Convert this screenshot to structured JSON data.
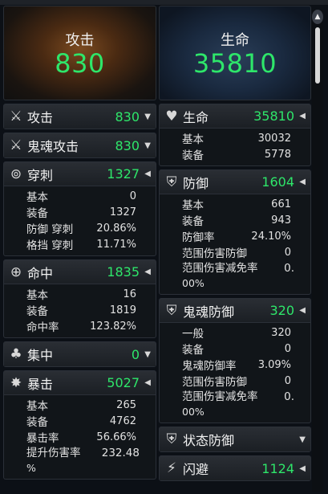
{
  "left": {
    "hero": {
      "label": "攻击",
      "value": "830"
    },
    "panels": [
      {
        "icon": "crossed-swords-icon",
        "glyph": "⚔",
        "title": "攻击",
        "value": "830",
        "arrow": "▼",
        "rows": []
      },
      {
        "icon": "crossed-swords-icon",
        "glyph": "⚔",
        "title": "鬼魂攻击",
        "value": "830",
        "arrow": "▼",
        "rows": []
      },
      {
        "icon": "pierce-icon",
        "glyph": "⊚",
        "title": "穿刺",
        "value": "1327",
        "arrow": "◀",
        "rows": [
          {
            "label": "基本",
            "value": "0"
          },
          {
            "label": "装备",
            "value": "1327"
          },
          {
            "label": "防御 穿刺",
            "value": "20.86%"
          },
          {
            "label": "格挡 穿刺",
            "value": "11.71%"
          }
        ]
      },
      {
        "icon": "target-icon",
        "glyph": "⊕",
        "title": "命中",
        "value": "1835",
        "arrow": "◀",
        "rows": [
          {
            "label": "基本",
            "value": "16"
          },
          {
            "label": "装备",
            "value": "1819"
          },
          {
            "label": "命中率",
            "value": "123.82%"
          }
        ]
      },
      {
        "icon": "cluster-icon",
        "glyph": "♣",
        "title": "集中",
        "value": "0",
        "arrow": "▼",
        "rows": []
      },
      {
        "icon": "burst-icon",
        "glyph": "✸",
        "title": "暴击",
        "value": "5027",
        "arrow": "◀",
        "rows": [
          {
            "label": "基本",
            "value": "265"
          },
          {
            "label": "装备",
            "value": "4762"
          },
          {
            "label": "暴击率",
            "value": "56.66%"
          }
        ],
        "wrapped": {
          "label": "提升伤害率",
          "value": "232.48",
          "cont": "%"
        }
      }
    ]
  },
  "right": {
    "hero": {
      "label": "生命",
      "value": "35810"
    },
    "health": {
      "icon": "heart-icon",
      "glyph": "♥",
      "title": "生命",
      "value": "35810",
      "arrow": "◀",
      "rows": [
        {
          "label": "基本",
          "value": "30032"
        },
        {
          "label": "装备",
          "value": "5778"
        }
      ]
    },
    "defense": {
      "icon": "shield-icon",
      "glyph": "⛨",
      "title": "防御",
      "value": "1604",
      "arrow": "◀",
      "rows": [
        {
          "label": "基本",
          "value": "661"
        },
        {
          "label": "装备",
          "value": "943"
        },
        {
          "label": "防御率",
          "value": "24.10%"
        },
        {
          "label": "范围伤害防御",
          "value": "0"
        }
      ],
      "wrapped": {
        "label": "范围伤害减免率",
        "value": "0.",
        "cont": "00%"
      }
    },
    "ghost_defense": {
      "icon": "ghost-shield-icon",
      "glyph": "⛨",
      "title": "鬼魂防御",
      "value": "320",
      "arrow": "◀",
      "rows": [
        {
          "label": "一般",
          "value": "320"
        },
        {
          "label": "装备",
          "value": "0"
        },
        {
          "label": "鬼魂防御率",
          "value": "3.09%"
        },
        {
          "label": "范围伤害防御",
          "value": "0"
        }
      ],
      "wrapped": {
        "label": "范围伤害减免率",
        "value": "0.",
        "cont": "00%"
      }
    },
    "status_defense": {
      "icon": "status-shield-icon",
      "glyph": "⛨",
      "title": "状态防御",
      "value": "",
      "arrow": "▼"
    },
    "evasion": {
      "icon": "lightning-icon",
      "glyph": "⚡",
      "title": "闪避",
      "value": "1124",
      "arrow": "◀"
    }
  },
  "scrollbar": {
    "up_glyph": "▲"
  }
}
